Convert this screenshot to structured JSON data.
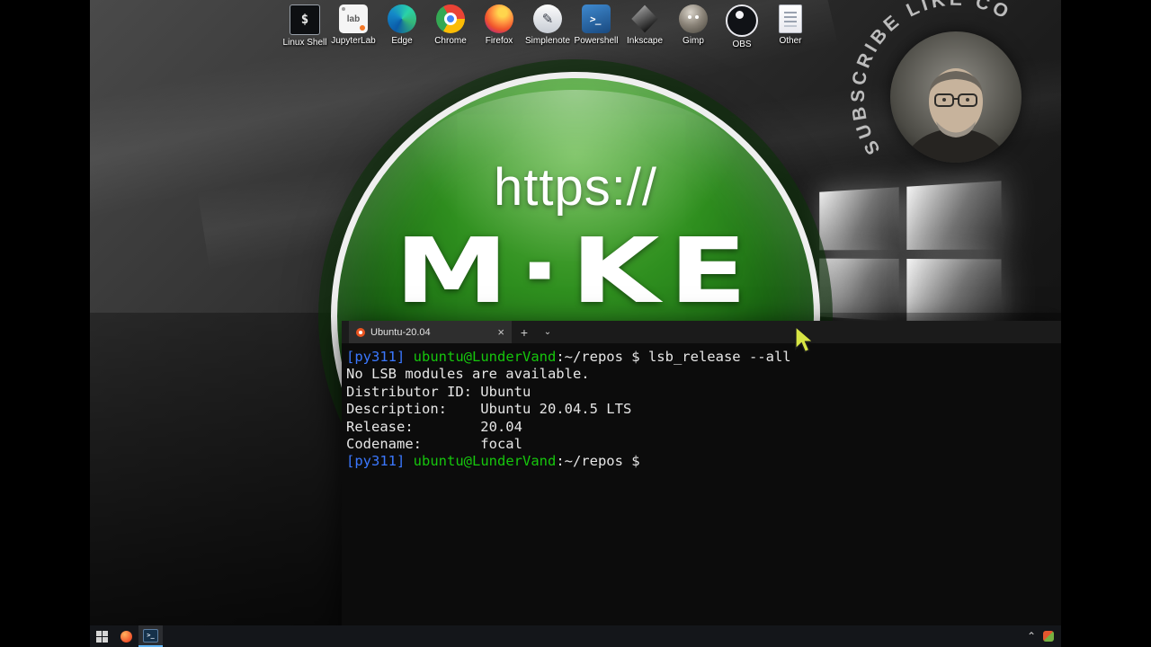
{
  "desktop": {
    "icons": [
      {
        "id": "linux-shell",
        "label": "Linux Shell",
        "glyph": "$"
      },
      {
        "id": "jupyterlab",
        "label": "JupyterLab",
        "glyph": "lab"
      },
      {
        "id": "edge",
        "label": "Edge",
        "glyph": ""
      },
      {
        "id": "chrome",
        "label": "Chrome",
        "glyph": ""
      },
      {
        "id": "firefox",
        "label": "Firefox",
        "glyph": ""
      },
      {
        "id": "simplenote",
        "label": "Simplenote",
        "glyph": "✎"
      },
      {
        "id": "powershell",
        "label": "Powershell",
        "glyph": ">_"
      },
      {
        "id": "inkscape",
        "label": "Inkscape",
        "glyph": ""
      },
      {
        "id": "gimp",
        "label": "Gimp",
        "glyph": ""
      },
      {
        "id": "obs",
        "label": "OBS",
        "glyph": ""
      },
      {
        "id": "other",
        "label": "Other",
        "glyph": ""
      }
    ]
  },
  "logo": {
    "line1": "https://",
    "line2": "M·KE"
  },
  "webcam": {
    "arc_text": "SUBSCRIBE LIKE CO"
  },
  "terminal": {
    "tab": {
      "title": "Ubuntu-20.04",
      "close_glyph": "×"
    },
    "new_tab_glyph": "+",
    "dropdown_glyph": "⌄",
    "colors": {
      "prompt_blue": "#3b78ff",
      "prompt_green": "#16c60c",
      "foreground": "#e6e6e6",
      "background": "#0c0c0c"
    },
    "lines": [
      {
        "segments": [
          {
            "text": "[py311]",
            "color": "blue"
          },
          {
            "text": " ",
            "color": "white"
          },
          {
            "text": "ubuntu@LunderVand",
            "color": "green"
          },
          {
            "text": ":~/repos $ lsb_release --all",
            "color": "white"
          }
        ]
      },
      {
        "segments": [
          {
            "text": "No LSB modules are available.",
            "color": "white"
          }
        ]
      },
      {
        "segments": [
          {
            "text": "Distributor ID: Ubuntu",
            "color": "white"
          }
        ]
      },
      {
        "segments": [
          {
            "text": "Description:    Ubuntu 20.04.5 LTS",
            "color": "white"
          }
        ]
      },
      {
        "segments": [
          {
            "text": "Release:        20.04",
            "color": "white"
          }
        ]
      },
      {
        "segments": [
          {
            "text": "Codename:       focal",
            "color": "white"
          }
        ]
      },
      {
        "segments": [
          {
            "text": "[py311]",
            "color": "blue"
          },
          {
            "text": " ",
            "color": "white"
          },
          {
            "text": "ubuntu@LunderVand",
            "color": "green"
          },
          {
            "text": ":~/repos $ ",
            "color": "white"
          }
        ]
      }
    ]
  },
  "taskbar": {
    "terminal_glyph": ">_",
    "tray_chevron": "⌃"
  }
}
